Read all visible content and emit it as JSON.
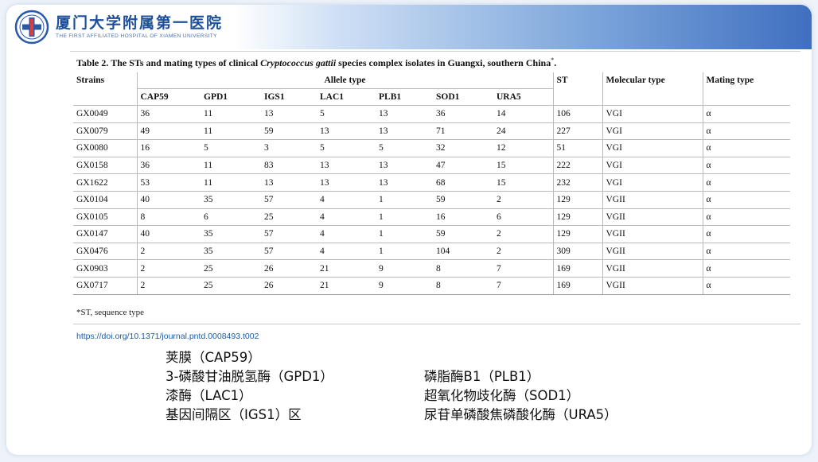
{
  "header": {
    "hospital_name_cn": "厦门大学附属第一医院",
    "hospital_name_en": "THE FIRST AFFILIATED HOSPITAL OF XIAMEN UNIVERSITY",
    "logo_icon": "hospital-emblem-icon"
  },
  "table": {
    "caption_prefix": "Table 2.",
    "caption_main": "The STs and mating types of clinical",
    "caption_italic": "Cryptococcus gattii",
    "caption_suffix": "species complex isolates in Guangxi, southern China",
    "caption_mark": "*",
    "caption_end": ".",
    "headers": {
      "strains": "Strains",
      "allele_type": "Allele type",
      "st": "ST",
      "molecular_type": "Molecular type",
      "mating_type": "Mating type"
    },
    "alleles": [
      "CAP59",
      "GPD1",
      "IGS1",
      "LAC1",
      "PLB1",
      "SOD1",
      "URA5"
    ],
    "rows": [
      [
        "GX0049",
        "36",
        "11",
        "13",
        "5",
        "13",
        "36",
        "14",
        "106",
        "VGI",
        "α"
      ],
      [
        "GX0079",
        "49",
        "11",
        "59",
        "13",
        "13",
        "71",
        "24",
        "227",
        "VGI",
        "α"
      ],
      [
        "GX0080",
        "16",
        "5",
        "3",
        "5",
        "5",
        "32",
        "12",
        "51",
        "VGI",
        "α"
      ],
      [
        "GX0158",
        "36",
        "11",
        "83",
        "13",
        "13",
        "47",
        "15",
        "222",
        "VGI",
        "α"
      ],
      [
        "GX1622",
        "53",
        "11",
        "13",
        "13",
        "13",
        "68",
        "15",
        "232",
        "VGI",
        "α"
      ],
      [
        "GX0104",
        "40",
        "35",
        "57",
        "4",
        "1",
        "59",
        "2",
        "129",
        "VGII",
        "α"
      ],
      [
        "GX0105",
        "8",
        "6",
        "25",
        "4",
        "1",
        "16",
        "6",
        "129",
        "VGII",
        "α"
      ],
      [
        "GX0147",
        "40",
        "35",
        "57",
        "4",
        "1",
        "59",
        "2",
        "129",
        "VGII",
        "α"
      ],
      [
        "GX0476",
        "2",
        "35",
        "57",
        "4",
        "1",
        "104",
        "2",
        "309",
        "VGII",
        "α"
      ],
      [
        "GX0903",
        "2",
        "25",
        "26",
        "21",
        "9",
        "8",
        "7",
        "169",
        "VGII",
        "α"
      ],
      [
        "GX0717",
        "2",
        "25",
        "26",
        "21",
        "9",
        "8",
        "7",
        "169",
        "VGII",
        "α"
      ]
    ],
    "footnote": "*ST, sequence type",
    "doi": "https://doi.org/10.1371/journal.pntd.0008493.t002"
  },
  "notes": {
    "left": [
      "荚膜（CAP59）",
      "3-磷酸甘油脱氢酶（GPD1）",
      "漆酶（LAC1）",
      "基因间隔区（IGS1）区"
    ],
    "right": [
      "磷脂酶B1（PLB1）",
      "超氧化物歧化酶（SOD1）",
      "尿苷单磷酸焦磷酸化酶（URA5）"
    ]
  },
  "colors": {
    "brand_blue": "#1d4f9c",
    "link_blue": "#1c5aa8",
    "band_dark": "#3f6fc0"
  }
}
